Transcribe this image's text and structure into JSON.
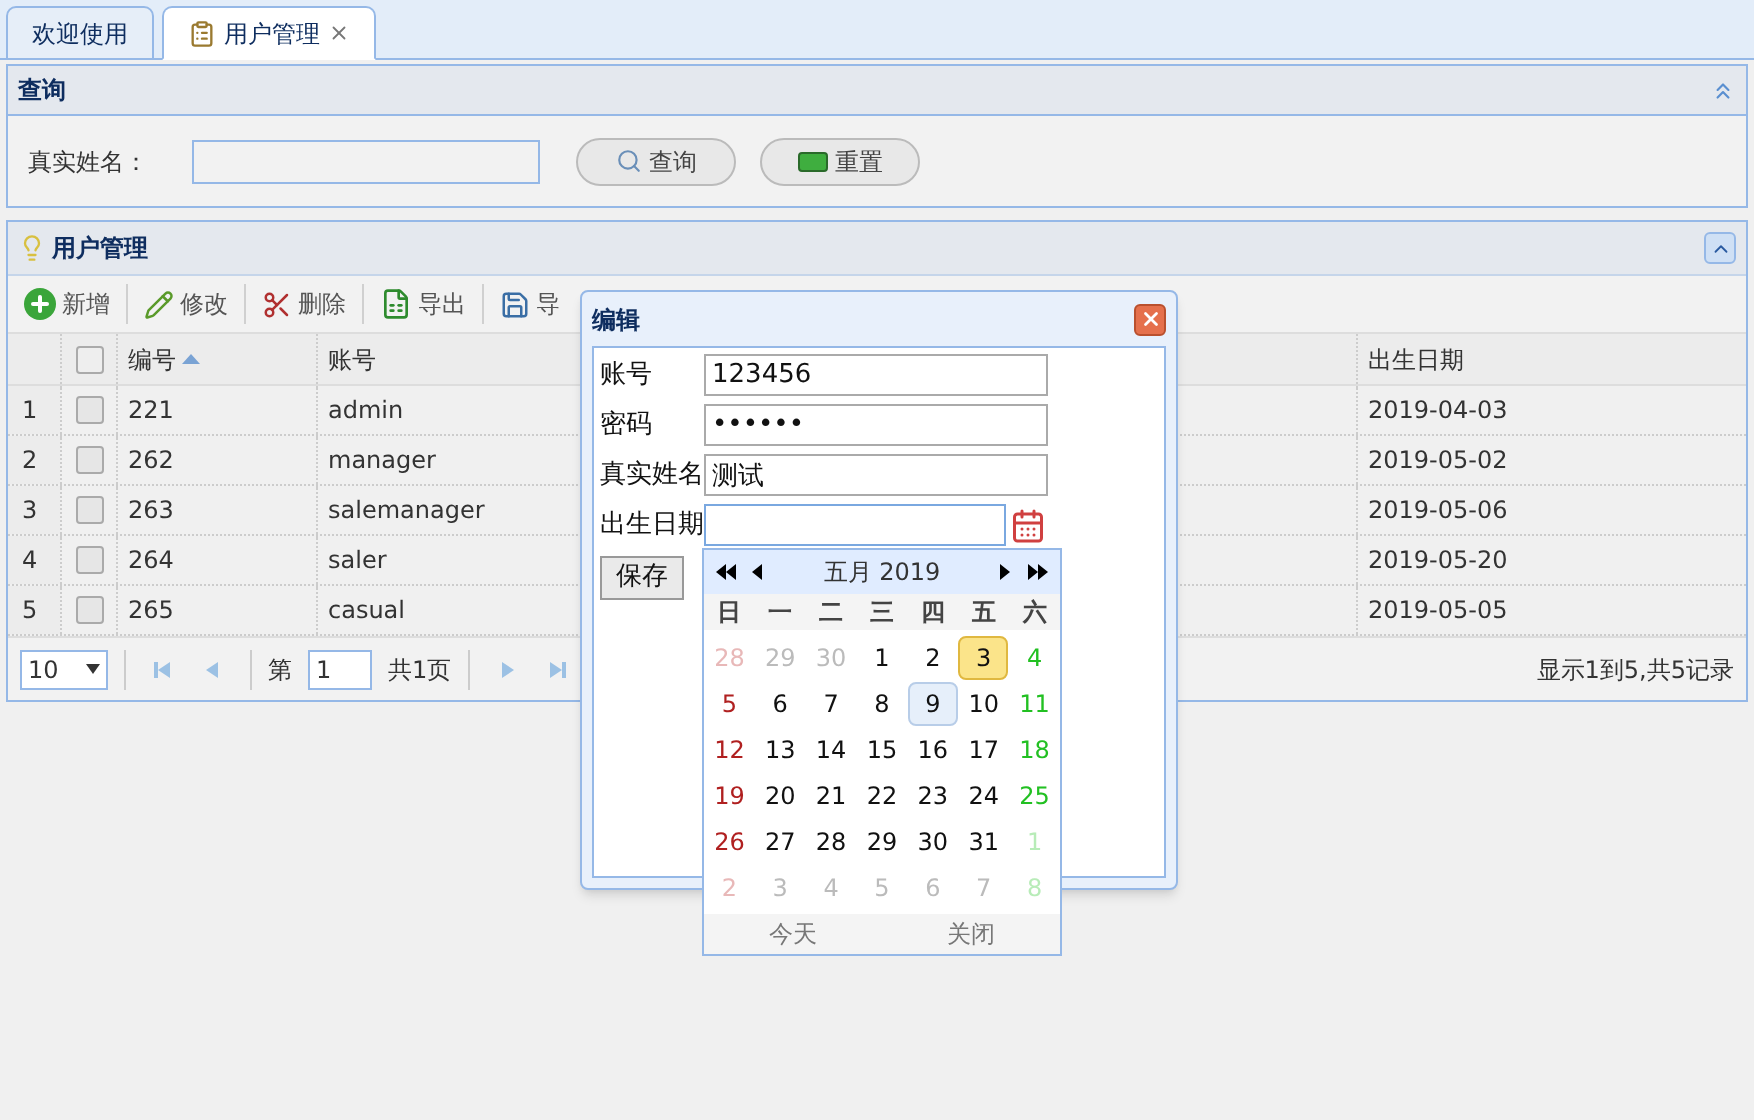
{
  "tabs": [
    {
      "label": "欢迎使用",
      "selected": false,
      "closable": false
    },
    {
      "label": "用户管理",
      "selected": true,
      "closable": true
    }
  ],
  "query_panel": {
    "title": "查询",
    "field_label": "真实姓名：",
    "buttons": [
      {
        "label": "查询",
        "kind": "search"
      },
      {
        "label": "重置",
        "kind": "reset"
      }
    ]
  },
  "user_panel": {
    "title": "用户管理",
    "toolbar": [
      {
        "label": "新增",
        "kind": "add"
      },
      {
        "label": "修改",
        "kind": "edit"
      },
      {
        "label": "删除",
        "kind": "delete"
      },
      {
        "label": "导出",
        "kind": "export"
      },
      {
        "label": "导",
        "kind": "import"
      }
    ],
    "table": {
      "all_checked": false,
      "columns": [
        "编号",
        "账号",
        "出生日期"
      ],
      "rows": [
        {
          "num": "1",
          "checked": false,
          "cells": [
            "221",
            "admin",
            "2019-04-03"
          ]
        },
        {
          "num": "2",
          "checked": false,
          "cells": [
            "262",
            "manager",
            "2019-05-02"
          ]
        },
        {
          "num": "3",
          "checked": false,
          "cells": [
            "263",
            "salemanager",
            "2019-05-06"
          ]
        },
        {
          "num": "4",
          "checked": false,
          "cells": [
            "264",
            "saler",
            "2019-05-20"
          ]
        },
        {
          "num": "5",
          "checked": false,
          "cells": [
            "265",
            "casual",
            "2019-05-05"
          ]
        }
      ]
    },
    "pager": {
      "page_size": "10",
      "page_label": "第",
      "page": "1",
      "pages_label": "共1页",
      "summary": "显示1到5,共5记录"
    }
  },
  "dialog": {
    "title": "编辑",
    "fields": [
      {
        "label": "账号",
        "value": "123456"
      },
      {
        "label": "密码",
        "value": "••••••"
      },
      {
        "label": "真实姓名",
        "value": "测试"
      },
      {
        "label": "出生日期"
      }
    ],
    "save": "保存"
  },
  "calendar": {
    "title": "五月 2019",
    "weekdays": [
      "日",
      "一",
      "二",
      "三",
      "四",
      "五",
      "六"
    ],
    "days": [
      {
        "label": "28",
        "outside": true,
        "selected": false,
        "today": false
      },
      {
        "label": "29",
        "outside": true,
        "selected": false,
        "today": false
      },
      {
        "label": "30",
        "outside": true,
        "selected": false,
        "today": false
      },
      {
        "label": "1",
        "outside": false,
        "selected": false,
        "today": false
      },
      {
        "label": "2",
        "outside": false,
        "selected": false,
        "today": false
      },
      {
        "label": "3",
        "outside": false,
        "selected": true,
        "today": false
      },
      {
        "label": "4",
        "outside": false,
        "selected": false,
        "today": false
      },
      {
        "label": "5",
        "outside": false,
        "selected": false,
        "today": false
      },
      {
        "label": "6",
        "outside": false,
        "selected": false,
        "today": false
      },
      {
        "label": "7",
        "outside": false,
        "selected": false,
        "today": false
      },
      {
        "label": "8",
        "outside": false,
        "selected": false,
        "today": false
      },
      {
        "label": "9",
        "outside": false,
        "selected": false,
        "today": true
      },
      {
        "label": "10",
        "outside": false,
        "selected": false,
        "today": false
      },
      {
        "label": "11",
        "outside": false,
        "selected": false,
        "today": false
      },
      {
        "label": "12",
        "outside": false,
        "selected": false,
        "today": false
      },
      {
        "label": "13",
        "outside": false,
        "selected": false,
        "today": false
      },
      {
        "label": "14",
        "outside": false,
        "selected": false,
        "today": false
      },
      {
        "label": "15",
        "outside": false,
        "selected": false,
        "today": false
      },
      {
        "label": "16",
        "outside": false,
        "selected": false,
        "today": false
      },
      {
        "label": "17",
        "outside": false,
        "selected": false,
        "today": false
      },
      {
        "label": "18",
        "outside": false,
        "selected": false,
        "today": false
      },
      {
        "label": "19",
        "outside": false,
        "selected": false,
        "today": false
      },
      {
        "label": "20",
        "outside": false,
        "selected": false,
        "today": false
      },
      {
        "label": "21",
        "outside": false,
        "selected": false,
        "today": false
      },
      {
        "label": "22",
        "outside": false,
        "selected": false,
        "today": false
      },
      {
        "label": "23",
        "outside": false,
        "selected": false,
        "today": false
      },
      {
        "label": "24",
        "outside": false,
        "selected": false,
        "today": false
      },
      {
        "label": "25",
        "outside": false,
        "selected": false,
        "today": false
      },
      {
        "label": "26",
        "outside": false,
        "selected": false,
        "today": false
      },
      {
        "label": "27",
        "outside": false,
        "selected": false,
        "today": false
      },
      {
        "label": "28",
        "outside": false,
        "selected": false,
        "today": false
      },
      {
        "label": "29",
        "outside": false,
        "selected": false,
        "today": false
      },
      {
        "label": "30",
        "outside": false,
        "selected": false,
        "today": false
      },
      {
        "label": "31",
        "outside": false,
        "selected": false,
        "today": false
      },
      {
        "label": "1",
        "outside": true,
        "selected": false,
        "today": false
      },
      {
        "label": "2",
        "outside": true,
        "selected": false,
        "today": false
      },
      {
        "label": "3",
        "outside": true,
        "selected": false,
        "today": false
      },
      {
        "label": "4",
        "outside": true,
        "selected": false,
        "today": false
      },
      {
        "label": "5",
        "outside": true,
        "selected": false,
        "today": false
      },
      {
        "label": "6",
        "outside": true,
        "selected": false,
        "today": false
      },
      {
        "label": "7",
        "outside": true,
        "selected": false,
        "today": false
      },
      {
        "label": "8",
        "outside": true,
        "selected": false,
        "today": false
      }
    ],
    "footer": [
      "今天",
      "关闭"
    ]
  }
}
